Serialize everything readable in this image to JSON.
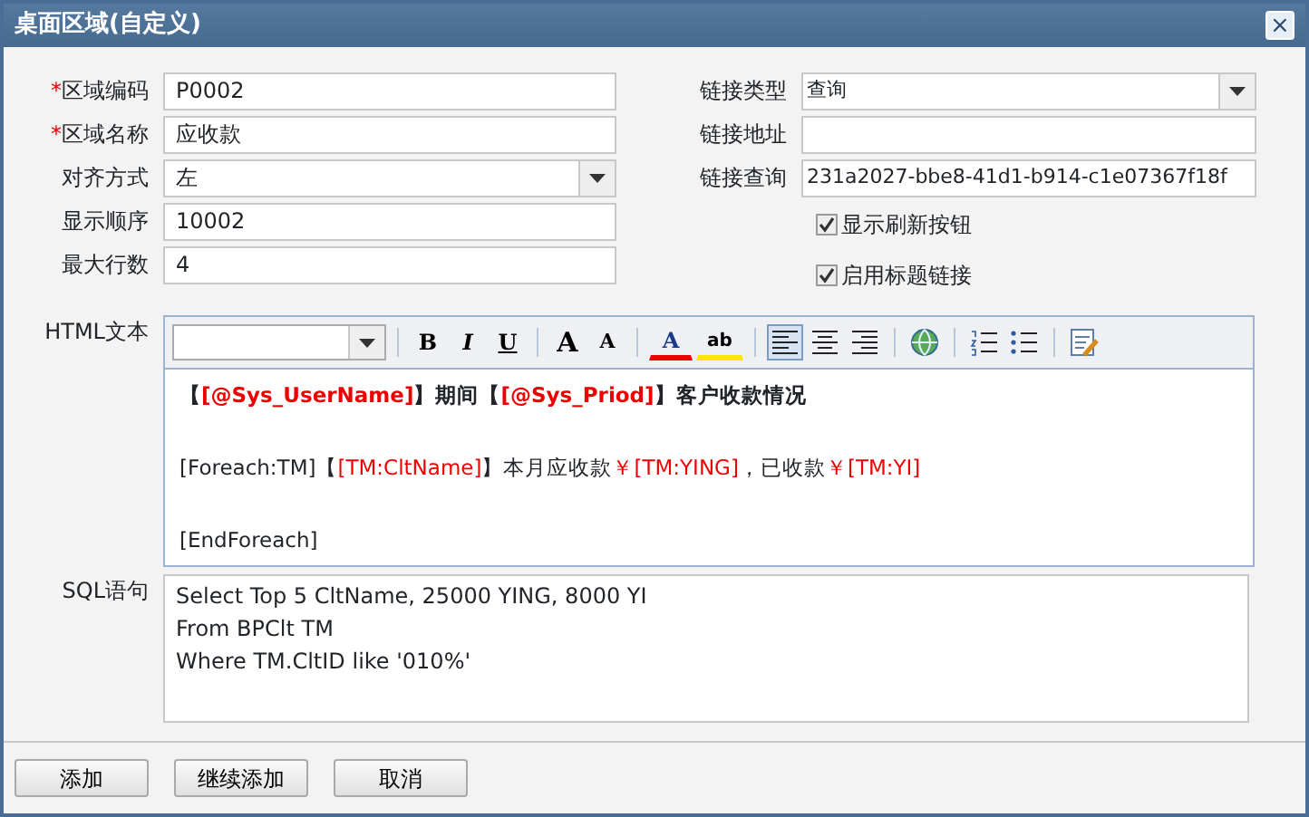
{
  "window": {
    "title": "桌面区域(自定义)",
    "close": "×"
  },
  "left_fields": [
    {
      "required_mark": "*",
      "label": "区域编码",
      "kind": "text",
      "value": "P0002"
    },
    {
      "required_mark": "*",
      "label": "区域名称",
      "kind": "text",
      "value": "应收款"
    },
    {
      "label": "对齐方式",
      "kind": "select",
      "value": "左"
    },
    {
      "label": "显示顺序",
      "kind": "text",
      "value": "10002"
    },
    {
      "label": "最大行数",
      "kind": "text",
      "value": "4"
    }
  ],
  "right_fields": [
    {
      "label": "链接类型",
      "kind": "select",
      "value": "查询"
    },
    {
      "label": "链接地址",
      "kind": "text"
    },
    {
      "label": "链接查询",
      "kind": "text",
      "value": "231a2027-bbe8-41d1-b914-c1e07367f18f"
    }
  ],
  "checkboxes": [
    {
      "label": "显示刷新按钮",
      "checked": true
    },
    {
      "label": "启用标题链接",
      "checked": true
    }
  ],
  "html_editor": {
    "label": "HTML文本",
    "toolbar": [
      [
        {
          "kind": "font-select"
        }
      ],
      [
        {
          "kind": "bold",
          "text": "B"
        },
        {
          "kind": "italic",
          "text": "I"
        },
        {
          "kind": "underline",
          "text": "U"
        }
      ],
      [
        {
          "kind": "grow",
          "text": "A"
        },
        {
          "kind": "shrink",
          "text": "A"
        }
      ],
      [
        {
          "kind": "font-color",
          "text": "A"
        },
        {
          "kind": "highlight",
          "text": "ab"
        }
      ],
      [
        {
          "kind": "align-left",
          "selected": true
        },
        {
          "kind": "align-center",
          "selected": false
        },
        {
          "kind": "align-right",
          "selected": false
        }
      ],
      [
        {
          "kind": "globe"
        }
      ],
      [
        {
          "kind": "ordered-list"
        },
        {
          "kind": "bullet-list"
        }
      ],
      [
        {
          "kind": "source"
        }
      ]
    ],
    "lines": [
      {
        "kind": "text",
        "bold": true,
        "segments": [
          {
            "kind": "text",
            "text": "【"
          },
          {
            "kind": "field",
            "text": "[@Sys_UserName]"
          },
          {
            "kind": "text",
            "text": "】期间【"
          },
          {
            "kind": "field",
            "text": "[@Sys_Priod]"
          },
          {
            "kind": "text",
            "text": "】客户收款情况"
          }
        ]
      },
      {
        "kind": "blank"
      },
      {
        "kind": "text",
        "bold": false,
        "segments": [
          {
            "kind": "text",
            "text": "[Foreach:TM]【"
          },
          {
            "kind": "field",
            "text": "[TM:CltName]"
          },
          {
            "kind": "text",
            "text": "】本月应收款"
          },
          {
            "kind": "field",
            "text": "￥[TM:YING]"
          },
          {
            "kind": "text",
            "text": "，已收款"
          },
          {
            "kind": "field",
            "text": "￥[TM:YI]"
          }
        ]
      },
      {
        "kind": "blank"
      },
      {
        "kind": "text",
        "bold": false,
        "segments": [
          {
            "kind": "text",
            "text": "[EndForeach]"
          }
        ]
      }
    ]
  },
  "sql": {
    "label": "SQL语句",
    "lines": [
      "Select Top 5 CltName, 25000 YING, 8000 YI",
      "From BPClt TM",
      "Where TM.CltID like '010%'"
    ]
  },
  "buttons": [
    "添加",
    "继续添加",
    "取消"
  ]
}
